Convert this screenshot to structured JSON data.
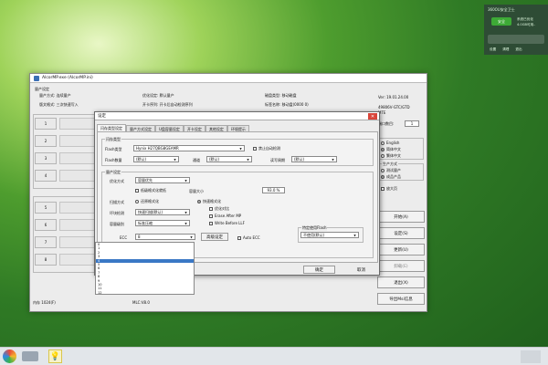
{
  "notif": {
    "title": "360OU安全卫士",
    "status": "安全",
    "line1": "系统已优化",
    "line2": "4.0GB可用..",
    "links": [
      "设置",
      "清理",
      "退出"
    ]
  },
  "window": {
    "title": "AlcorMP.exe (AlcorMP.ini)",
    "top_title": "量产设定",
    "info": [
      {
        "label": "量产方式: 连续量产",
        "x": "优化设定: 默认量产",
        "y": "磁盘类型: 移动磁盘"
      },
      {
        "label": "版文格式: 三次快速写入",
        "x": "开卡序列: 开卡后自动检测序列",
        "y": "标签名称: 移动盘(0000 0)"
      }
    ],
    "version": "Ver: 19.01.24.00",
    "fw": "49806V-GTC/GTD",
    "fw2": "MTE",
    "port_label": "端口数目:",
    "port_value": "1",
    "slots_top": [
      "1",
      "2",
      "3",
      "4"
    ],
    "slots_bottom": [
      "5",
      "6",
      "7",
      "8"
    ],
    "lang": {
      "title": "",
      "options": [
        "English",
        "简体中文",
        "繁体中文"
      ]
    },
    "prod": {
      "title": "生产方式",
      "options": [
        "测试量产",
        "成品产品"
      ]
    },
    "enlarge": "放大页",
    "side_buttons": [
      "开始(A)",
      "设定(S)",
      "更新(U)",
      "卸载(E)",
      "退出(X)",
      "导出Msi信息"
    ],
    "bottom_left": "内存 1024(F)",
    "bottom_mid": "MLC:V8.0",
    "load_button": "导入配置"
  },
  "dialog": {
    "title": "设定",
    "tabs": [
      "闪存类型设定",
      "量产方式设定",
      "U盘容量设定",
      "开卡设定",
      "其他设定",
      "环境提示"
    ],
    "flash_group": "闪存类型",
    "flash_type_label": "Flash类型",
    "flash_type_value": "Hynix H27QBG8GEAMR",
    "auto_detect": "禁止自动检测",
    "flash_count_label": "Flash数量",
    "flash_count_value": "(默认)",
    "channel_label": "通道",
    "channel_value": "(默认)",
    "cycle_label": "读写周期",
    "cycle_value": "(默认)",
    "mp_group": "量产设定",
    "opt_label": "优化方式",
    "opt_value": "容量优先",
    "chk_lowlevel": "低级格式化就低",
    "cap_label": "容量大小",
    "cap_value": "93.0 %",
    "scan_label": "扫描方式",
    "scan_opt1": "还原格式化",
    "scan_opt2": "快速格式化",
    "check_label": "坏块检测",
    "check_value": "快速扫描(默认)",
    "chk_opt1": "优化对比",
    "chk_opt2": "Erase After MP",
    "chk_opt3": "Write Before LLF",
    "level_label": "容量级别",
    "level_value": "标准压缩",
    "ecc_label": "ECC",
    "ecc_value": "8",
    "ecc_adv": "高级设定",
    "auto_ecc": "Auto ECC",
    "flash_sel_group": "特定使用Flash",
    "flash_sel_value": "不使用(默认)",
    "ecc_list": [
      "0",
      "1",
      "2",
      "3",
      "4",
      "5",
      "6",
      "7",
      "8",
      "9",
      "10",
      "11",
      "12",
      "13"
    ],
    "ok": "确定",
    "cancel": "取消"
  },
  "taskbar": {
    "time": "",
    "date": ""
  }
}
